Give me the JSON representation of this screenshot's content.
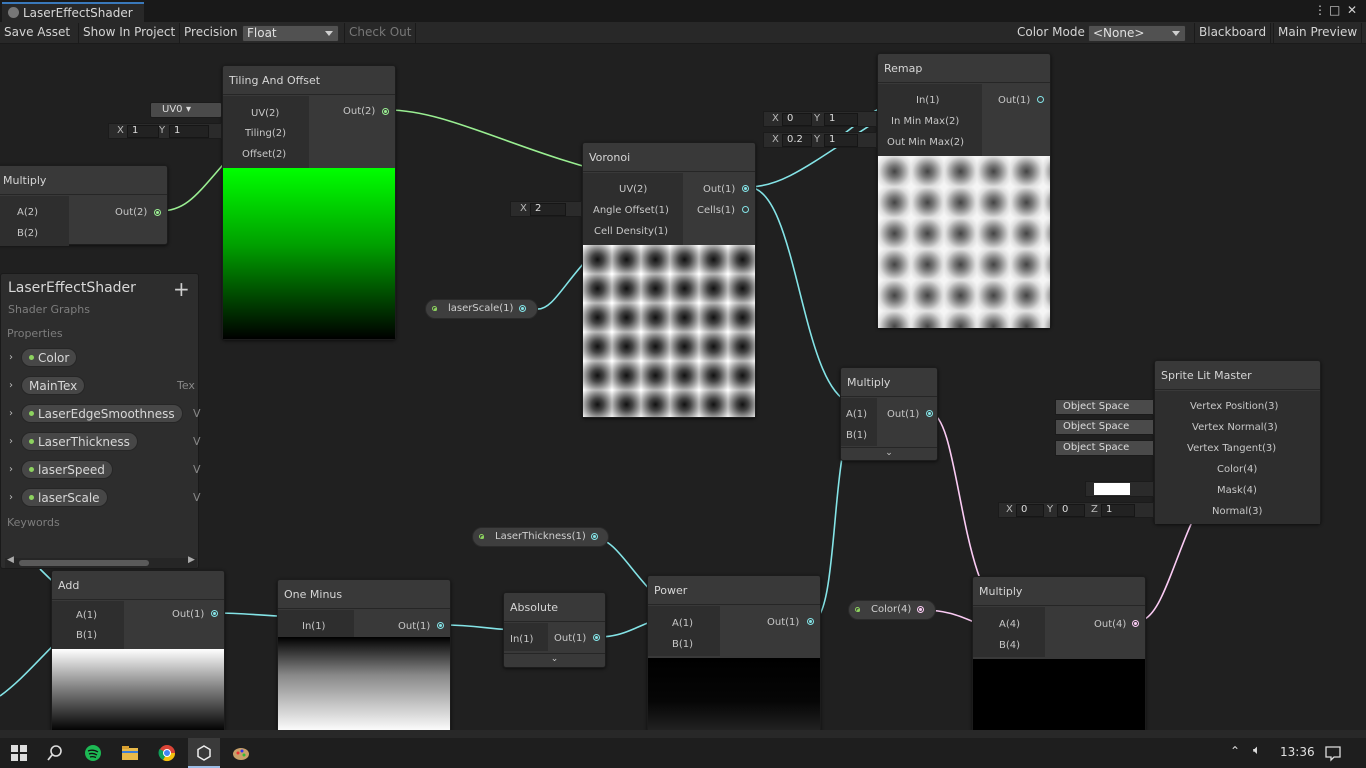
{
  "window": {
    "tab_title": "LaserEffectShader"
  },
  "toolbar": {
    "save_asset": "Save Asset",
    "show_in_project": "Show In Project",
    "precision_label": "Precision",
    "precision_value": "Float",
    "check_out": "Check Out",
    "color_mode_label": "Color Mode",
    "color_mode_value": "<None>",
    "blackboard": "Blackboard",
    "main_preview": "Main Preview"
  },
  "nodes": {
    "tiling": {
      "title": "Tiling And Offset",
      "in1": "UV(2)",
      "in2": "Tiling(2)",
      "in3": "Offset(2)",
      "out": "Out(2)",
      "uv_dropdown": "UV0",
      "x_label": "X",
      "x_val": "1",
      "y_label": "Y",
      "y_val": "1"
    },
    "multiply_left": {
      "title": "Multiply",
      "in1": "A(2)",
      "in2": "B(2)",
      "out": "Out(2)"
    },
    "voronoi": {
      "title": "Voronoi",
      "in1": "UV(2)",
      "in2": "Angle Offset(1)",
      "in3": "Cell Density(1)",
      "out1": "Out(1)",
      "out2": "Cells(1)",
      "x_label": "X",
      "x_val": "2"
    },
    "remap": {
      "title": "Remap",
      "in1": "In(1)",
      "in2": "In Min Max(2)",
      "in3": "Out Min Max(2)",
      "out": "Out(1)",
      "r1_x": "0",
      "r1_y": "1",
      "r2_x": "0.2",
      "r2_y": "1",
      "x_label": "X",
      "y_label": "Y"
    },
    "multiply_mid": {
      "title": "Multiply",
      "in1": "A(1)",
      "in2": "B(1)",
      "out": "Out(1)"
    },
    "sprite_master": {
      "title": "Sprite Lit Master",
      "in1": "Vertex Position(3)",
      "in2": "Vertex Normal(3)",
      "in3": "Vertex Tangent(3)",
      "in4": "Color(4)",
      "in5": "Mask(4)",
      "in6": "Normal(3)",
      "space1": "Object Space",
      "space2": "Object Space",
      "space3": "Object Space",
      "x_label": "X",
      "x_val": "0",
      "y_label": "Y",
      "y_val": "0",
      "z_label": "Z",
      "z_val": "1"
    },
    "add": {
      "title": "Add",
      "in1": "A(1)",
      "in2": "B(1)",
      "out": "Out(1)"
    },
    "one_minus": {
      "title": "One Minus",
      "in1": "In(1)",
      "out": "Out(1)"
    },
    "absolute": {
      "title": "Absolute",
      "in1": "In(1)",
      "out": "Out(1)"
    },
    "power": {
      "title": "Power",
      "in1": "A(1)",
      "in2": "B(1)",
      "out": "Out(1)"
    },
    "multiply_bottom": {
      "title": "Multiply",
      "in1": "A(4)",
      "in2": "B(4)",
      "out": "Out(4)"
    }
  },
  "properties_nodes": {
    "laser_scale": "laserScale(1)",
    "laser_thickness": "LaserThickness(1)",
    "color": "Color(4)"
  },
  "blackboard": {
    "title": "LaserEffectShader",
    "subtitle": "Shader Graphs",
    "properties_label": "Properties",
    "keywords_label": "Keywords",
    "items": [
      {
        "name": "Color",
        "type": ""
      },
      {
        "name": "MainTex",
        "type": "Tex"
      },
      {
        "name": "LaserEdgeSmoothness",
        "type": "V"
      },
      {
        "name": "LaserThickness",
        "type": "V"
      },
      {
        "name": "laserSpeed",
        "type": "V"
      },
      {
        "name": "laserScale",
        "type": "V"
      }
    ]
  },
  "taskbar": {
    "time": "13:36"
  },
  "colors": {
    "float_wire": "#84e4e7",
    "vector2_wire": "#9aef92",
    "vector4_wire": "#fbcbf4",
    "accent": "#3a79bb"
  }
}
